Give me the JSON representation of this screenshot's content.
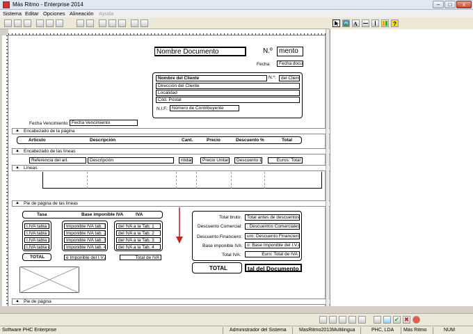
{
  "window": {
    "title": "Más Ritmo - Enterprise 2014",
    "minimize": "–",
    "maximize": "□",
    "close": "x"
  },
  "menu": [
    "Sistema",
    "Editar",
    "Opciones",
    "Alineación",
    "Ayuda"
  ],
  "document": {
    "title_field": "Nombre Documento",
    "number_label": "N.º",
    "number_field": "mento",
    "date_label": "Fecha:",
    "date_field": "Fecha docur",
    "client": {
      "name": "Nombre del Cliente",
      "no_label": "N.º:",
      "no_field": "del Cliente",
      "address": "Dirección del Cliente",
      "city": "Localidad",
      "postal": "Cód. Postal",
      "nif_label": "N.I.F.:",
      "nif_field": "Número de Contribuyente"
    },
    "due_label": "Fecha Vencimiento:",
    "due_field": "Fecha Vencimiento"
  },
  "sections": {
    "page_header": "Encabezado de la página",
    "lines_header": "Encabezado de las líneas",
    "lines": "Líneas",
    "lines_footer": "Pie de página de las líneas",
    "page_footer": "Pie de página"
  },
  "columns": {
    "article": "Artículo",
    "description": "Descripción",
    "qty": "Cant.",
    "price": "Precio",
    "discount": "Descuento %",
    "total": "Total"
  },
  "line_fields": {
    "ref": "Referencia del art.",
    "desc": "Descripción",
    "qty": "ntidad",
    "price": "Precio Unitario",
    "disc": "Descuento 1",
    "total": "Euros: Total"
  },
  "tax_table": {
    "headers": [
      "Tasa",
      "Base imponible IVA",
      "IVA"
    ],
    "rates": [
      "I.IVA tabla 1",
      "I.IVA tabla 2",
      "I.IVA tabla 3",
      "I.IVA tabla 4"
    ],
    "bases": [
      "Imponible IVA tab. 1",
      "Imponible IVA tab. 2",
      "Imponible IVA tab. 3",
      "Imponible IVA tab. 4"
    ],
    "ivas": [
      "del IVA a la Tab. 1",
      "del IVA a la Tab. 2",
      "del IVA a la Tab. 3",
      "del IVA a la Tab. 4"
    ],
    "total_label": "TOTAL",
    "total_base": "e Imponible del I.V.A.",
    "total_iva": "Total de IVA"
  },
  "totals": {
    "labels": [
      "Total bruto:",
      "Descuento Comercial:",
      "Descuento Financiero:",
      "Base imponible IVA:",
      "Total IVA:"
    ],
    "fields": [
      "Total antes de descuentos",
      ": Descuentos Comerciales",
      "uro: Descuento Financiero",
      "o: Base Imponible del I.V.A.",
      "Euro: Total de IVA"
    ],
    "grand_label": "TOTAL",
    "grand_field": "tal del Documento"
  },
  "statusbar": {
    "app": "Software PHC Enterprise",
    "user": "Administrador del Sistema",
    "db": "MasRitmo2013Multilingua",
    "company": "PHC, LDA",
    "module": "Más Ritmo",
    "num": "NUM"
  },
  "icons": [
    "pointer-icon",
    "image-icon",
    "text-icon",
    "line-icon",
    "vline-icon",
    "barcode-icon",
    "help-icon"
  ],
  "colors": {
    "arrow": "#c0281c",
    "close": "#c7472f"
  }
}
